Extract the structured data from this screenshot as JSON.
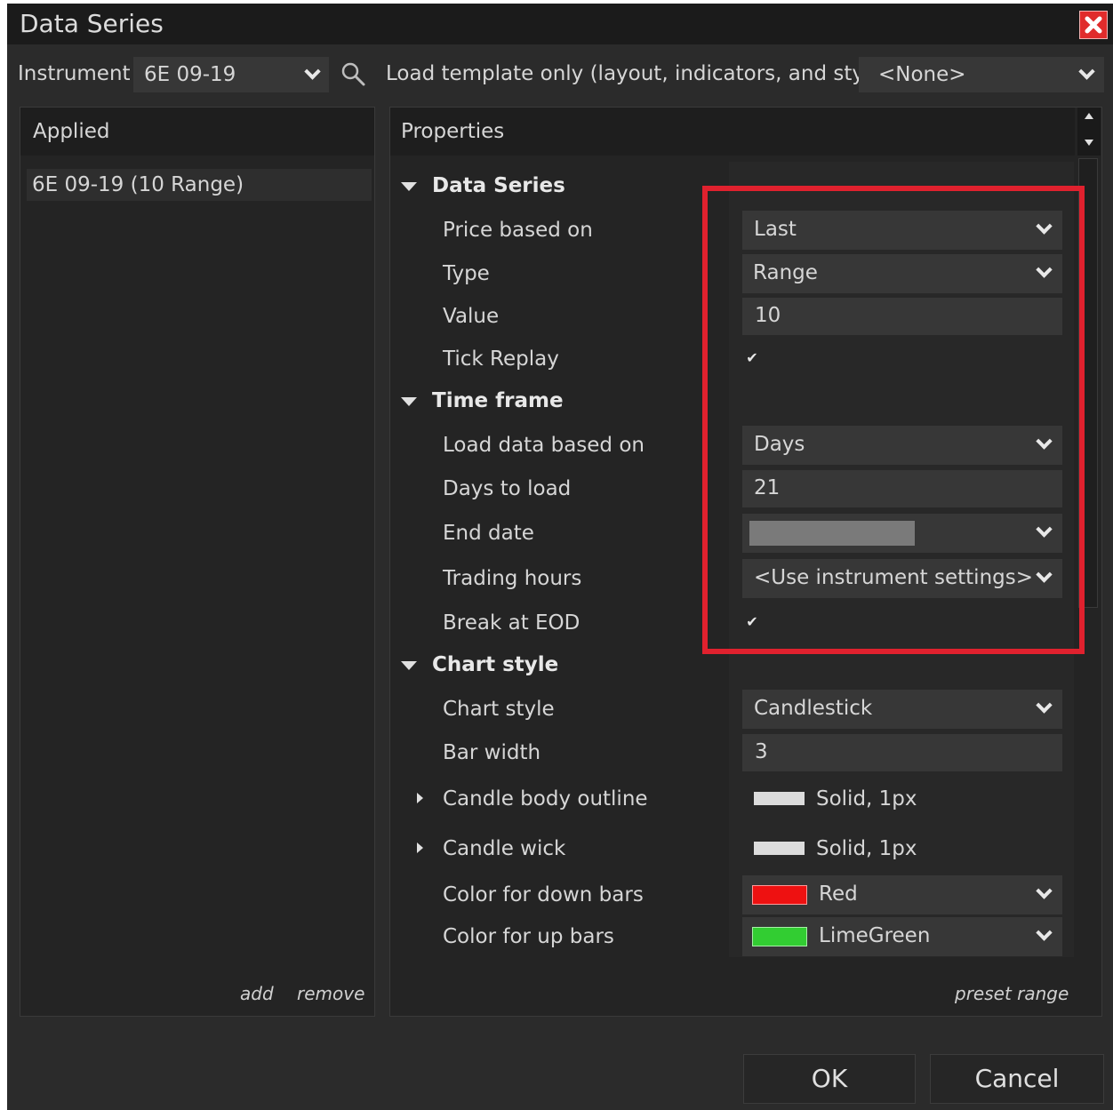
{
  "window": {
    "title": "Data Series"
  },
  "top": {
    "instrument_label": "Instrument",
    "instrument_value": "6E 09-19",
    "template_label": "Load template only (layout, indicators, and style)",
    "template_value": "<None>"
  },
  "applied": {
    "header": "Applied",
    "items": [
      "6E 09-19 (10 Range)"
    ],
    "add": "add",
    "remove": "remove"
  },
  "properties": {
    "header": "Properties",
    "data_series": {
      "section": "Data Series",
      "price_based_on_label": "Price based on",
      "price_based_on": "Last",
      "type_label": "Type",
      "type": "Range",
      "value_label": "Value",
      "value": "10",
      "tick_replay_label": "Tick Replay",
      "tick_replay": "✔"
    },
    "time_frame": {
      "section": "Time frame",
      "load_label": "Load data based on",
      "load": "Days",
      "days_label": "Days to load",
      "days": "21",
      "end_date_label": "End date",
      "trading_hours_label": "Trading hours",
      "trading_hours": "<Use instrument settings>",
      "break_eod_label": "Break at EOD",
      "break_eod": "✔"
    },
    "chart_style": {
      "section": "Chart style",
      "style_label": "Chart style",
      "style": "Candlestick",
      "bar_width_label": "Bar width",
      "bar_width": "3",
      "outline_label": "Candle body outline",
      "outline": "Solid, 1px",
      "wick_label": "Candle wick",
      "wick": "Solid, 1px",
      "down_label": "Color for down bars",
      "down": "Red",
      "up_label": "Color for up bars",
      "up": "LimeGreen"
    },
    "preset_range": "preset range"
  },
  "buttons": {
    "ok": "OK",
    "cancel": "Cancel"
  },
  "colors": {
    "highlight": "#e0212e",
    "down_swatch": "#ee1111",
    "up_swatch": "#32cd32",
    "stroke_swatch": "#dcdcdc"
  }
}
